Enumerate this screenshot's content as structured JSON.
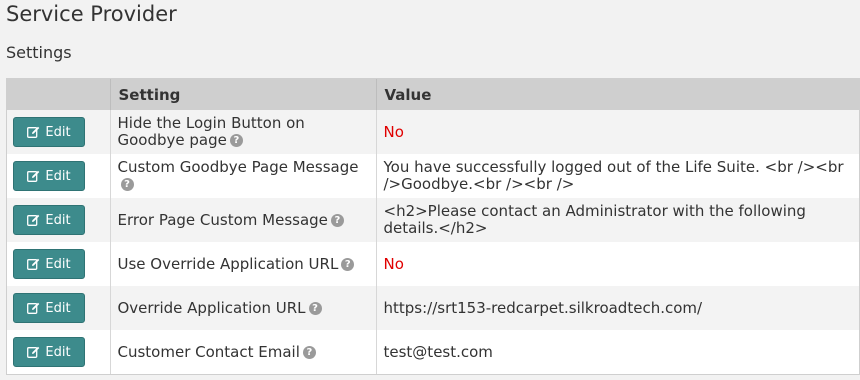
{
  "page_title": "Service Provider",
  "section_title": "Settings",
  "table": {
    "headers": [
      "",
      "Setting",
      "Value"
    ],
    "edit_label": "Edit",
    "rows": [
      {
        "setting": "Hide the Login Button on Goodbye page",
        "value": "No",
        "value_color": "#e00000"
      },
      {
        "setting": "Custom Goodbye Page Message",
        "value": "You have successfully logged out of the Life Suite. <br /><br />Goodbye.<br /><br />"
      },
      {
        "setting": "Error Page Custom Message",
        "value": "<h2>Please contact an Administrator with the following details.</h2>"
      },
      {
        "setting": "Use Override Application URL",
        "value": "No",
        "value_color": "#e00000"
      },
      {
        "setting": "Override Application URL",
        "value": "https://srt153-redcarpet.silkroadtech.com/"
      },
      {
        "setting": "Customer Contact Email",
        "value": "test@test.com"
      }
    ]
  },
  "colors": {
    "accent": "#3d8b8c",
    "header_bg": "#cfcfcf",
    "no_value": "#e00000"
  },
  "icons": {
    "edit": "edit-icon",
    "help": "question-circle-icon"
  }
}
